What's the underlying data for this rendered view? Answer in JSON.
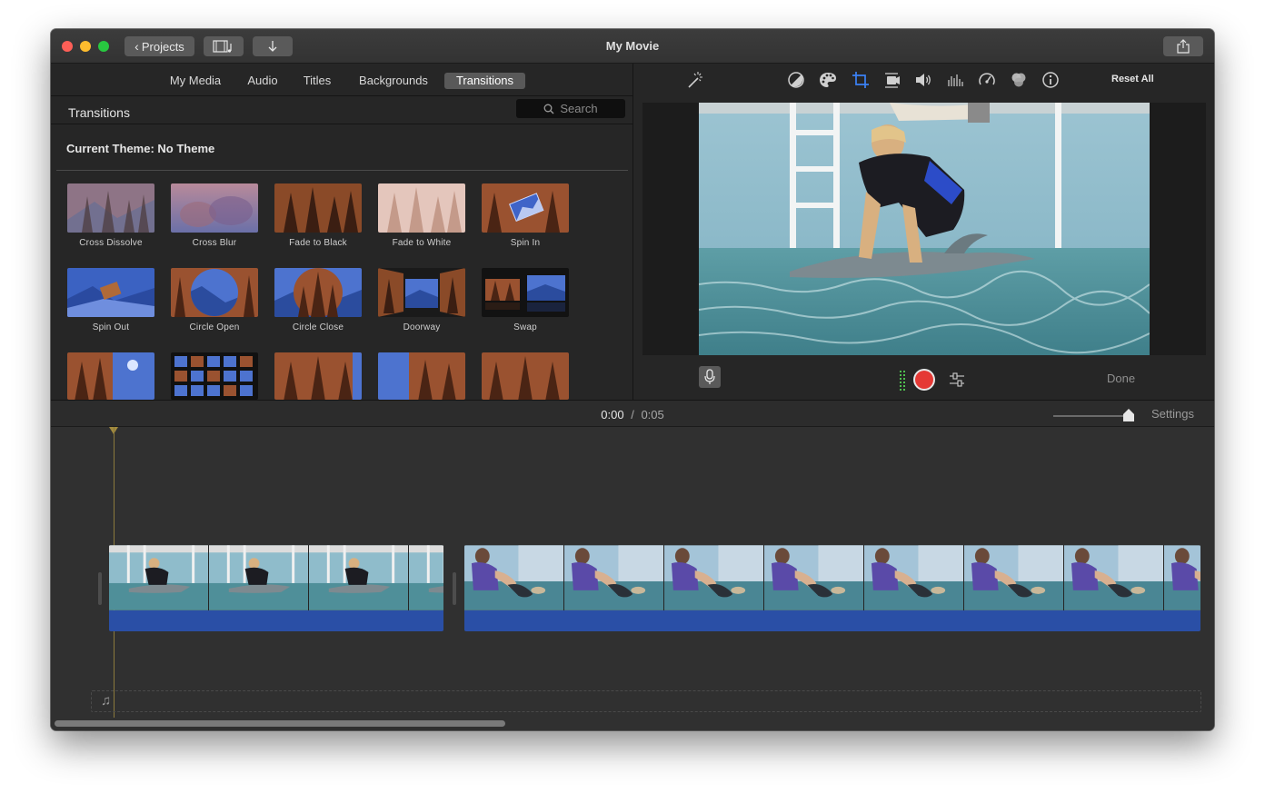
{
  "window": {
    "title": "My Movie",
    "projects_label": "Projects"
  },
  "tabs": [
    {
      "label": "My Media"
    },
    {
      "label": "Audio"
    },
    {
      "label": "Titles"
    },
    {
      "label": "Backgrounds"
    },
    {
      "label": "Transitions",
      "active": true
    }
  ],
  "browser": {
    "section_title": "Transitions",
    "search_placeholder": "Search",
    "theme_label": "Current Theme: No Theme",
    "transitions": [
      {
        "name": "Cross Dissolve"
      },
      {
        "name": "Cross Blur"
      },
      {
        "name": "Fade to Black"
      },
      {
        "name": "Fade to White"
      },
      {
        "name": "Spin In"
      },
      {
        "name": "Spin Out"
      },
      {
        "name": "Circle Open"
      },
      {
        "name": "Circle Close"
      },
      {
        "name": "Doorway"
      },
      {
        "name": "Swap"
      }
    ]
  },
  "viewer": {
    "tools": [
      "magic-wand-icon",
      "color-balance-icon",
      "color-palette-icon",
      "crop-icon",
      "stabilization-icon",
      "volume-icon",
      "equalizer-icon",
      "speed-icon",
      "clip-filter-icon",
      "info-icon"
    ],
    "active_tool": "crop-icon",
    "reset_all": "Reset All",
    "done": "Done"
  },
  "timeline": {
    "current_time": "0:00",
    "separator": "/",
    "total_time": "0:05",
    "settings": "Settings"
  },
  "colors": {
    "accent": "#3b82f6",
    "record": "#e53935",
    "audio_waveform": "#2a4fa6"
  }
}
